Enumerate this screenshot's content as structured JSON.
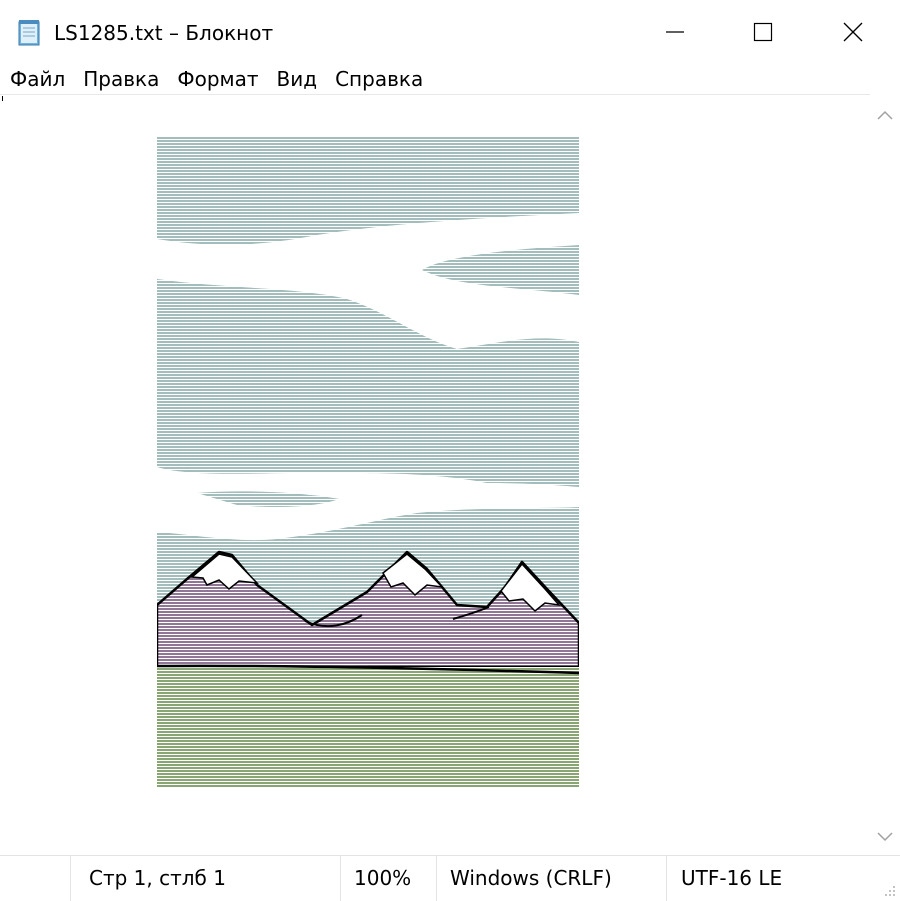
{
  "window": {
    "title": "LS1285.txt – Блокнот",
    "app_icon": "notepad-icon",
    "controls": {
      "minimize_icon": "minimize-icon",
      "maximize_icon": "maximize-icon",
      "close_icon": "close-icon"
    }
  },
  "menubar": {
    "items": [
      {
        "label": "Файл"
      },
      {
        "label": "Правка"
      },
      {
        "label": "Формат"
      },
      {
        "label": "Вид"
      },
      {
        "label": "Справка"
      }
    ]
  },
  "document": {
    "content_description_icon": "ascii-art-mountains",
    "colors": {
      "sky": "#a3bcbc",
      "mountain": "#8e7694",
      "grass": "#8aa574",
      "snow": "#ffffff",
      "outline": "#000000"
    }
  },
  "scrollbar": {
    "up_icon": "chevron-up-icon",
    "down_icon": "chevron-down-icon"
  },
  "statusbar": {
    "position": "Стр 1, стлб 1",
    "zoom": "100%",
    "line_endings": "Windows (CRLF)",
    "encoding": "UTF-16 LE",
    "grip_icon": "resize-grip-icon"
  }
}
